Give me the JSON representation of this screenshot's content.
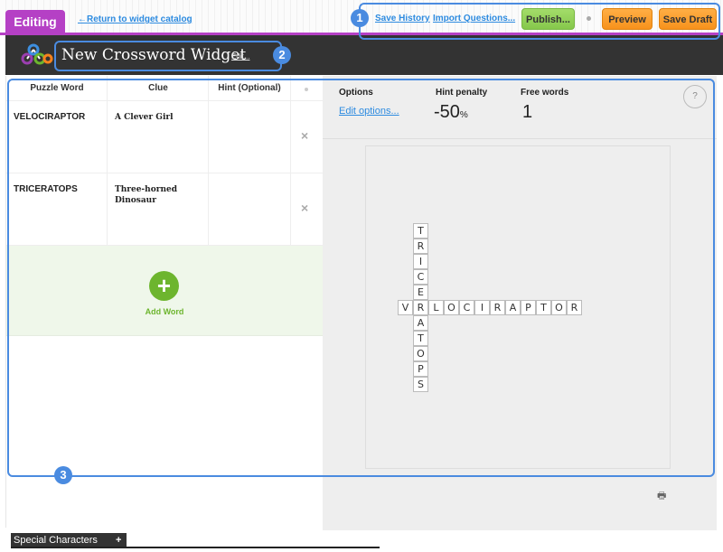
{
  "topbar": {
    "editing_tab": "Editing",
    "return_link": "←Return to widget catalog",
    "save_history": "Save History",
    "import_questions": "Import Questions...",
    "publish": "Publish...",
    "preview": "Preview",
    "save_draft": "Save Draft"
  },
  "header": {
    "title": "New Crossword Widget",
    "edit_link": "Edit..."
  },
  "callouts": [
    "1",
    "2",
    "3"
  ],
  "table": {
    "headers": [
      "Puzzle Word",
      "Clue",
      "Hint (Optional)"
    ],
    "rows": [
      {
        "word": "VELOCIRAPTOR",
        "clue": "A Clever Girl",
        "hint": ""
      },
      {
        "word": "TRICERATOPS",
        "clue": "Three-horned Dinosaur",
        "hint": ""
      }
    ],
    "delete_icon": "×",
    "add_label": "Add Word",
    "add_icon": "+"
  },
  "options": {
    "options_label": "Options",
    "edit_options": "Edit options...",
    "hint_penalty_label": "Hint penalty",
    "hint_penalty_value": "-50",
    "hint_penalty_unit": "%",
    "free_words_label": "Free words",
    "free_words_value": "1",
    "help_icon": "?"
  },
  "crossword": {
    "across": {
      "word": "VELOCIRAPTOR",
      "row": 5,
      "col": 0
    },
    "down": {
      "word": "TRICERATOPS",
      "row": 0,
      "col": 1
    }
  },
  "print_icon": "🖶",
  "special_characters": {
    "label": "Special Characters",
    "toggle": "+"
  }
}
